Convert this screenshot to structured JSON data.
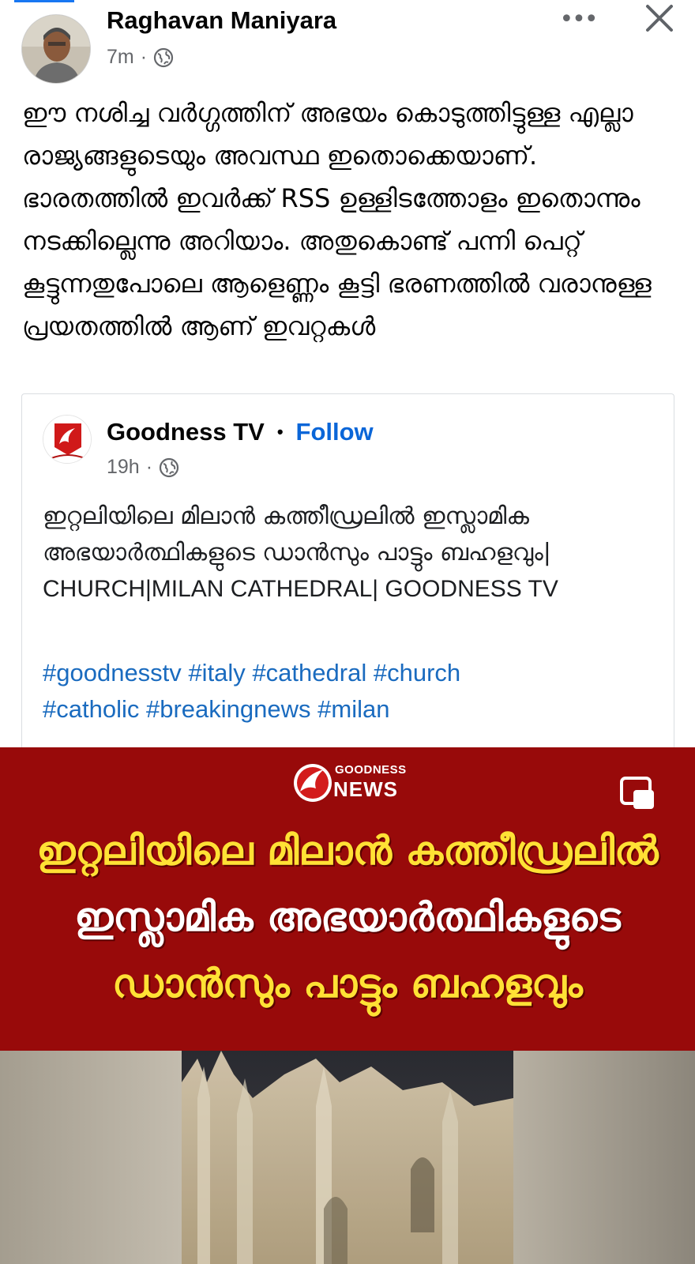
{
  "post": {
    "author": "Raghavan Maniyara",
    "time": "7m",
    "separator": "·",
    "privacy_icon": "globe-icon",
    "more_icon": "more-horizontal-icon",
    "more_glyph": "•••",
    "close_icon": "close-icon",
    "text": "ഈ നശിച്ച വർഗ്ഗത്തിന് അഭയം കൊടുത്തിട്ടുള്ള എല്ലാ രാജ്യങ്ങളുടെയും അവസ്ഥ ഇതൊക്കെയാണ്. ഭാരതത്തിൽ ഇവർക്ക് RSS ഉള്ളിടത്തോളം ഇതൊന്നും നടക്കില്ലെന്നു അറിയാം. അതുകൊണ്ട് പന്നി പെറ്റ് കൂട്ടുന്നതുപോലെ ആളെണ്ണം കൂട്ടി ഭരണത്തിൽ വരാനുള്ള പ്രയതത്തിൽ ആണ് ഇവറ്റകൾ"
  },
  "shared": {
    "page_name": "Goodness TV",
    "separator": "•",
    "follow_label": "Follow",
    "time": "19h",
    "meta_separator": "·",
    "privacy_icon": "globe-icon",
    "text_malayalam": "ഇറ്റലിയിലെ മിലാൻ കത്തീഡ്രലിൽ ഇസ്ലാമിക അഭയാർത്ഥികളുടെ ഡാൻസും പാട്ടും ബഹളവും|",
    "text_caps": " CHURCH|MILAN CATHEDRAL| GOODNESS TV",
    "hashtags": [
      "#goodnesstv",
      "#italy",
      "#cathedral",
      "#church",
      "#catholic",
      "#breakingnews",
      "#milan"
    ]
  },
  "video": {
    "logo_line1": "GOODNESS",
    "logo_line2": "NEWS",
    "pip_icon": "picture-in-picture-icon",
    "headline_1": "ഇറ്റലിയിലെ മിലാൻ കത്തീഡ്രലിൽ",
    "headline_2": "ഇസ്ലാമിക അഭയാർത്ഥികളുടെ",
    "headline_3": "ഡാൻസും പാട്ടും ബഹളവും"
  },
  "colors": {
    "accent": "#1877f2",
    "follow": "#0a66d8",
    "hashtag": "#1a6bbf",
    "banner_bg": "#980a0a",
    "headline_yellow": "#ffe135"
  }
}
